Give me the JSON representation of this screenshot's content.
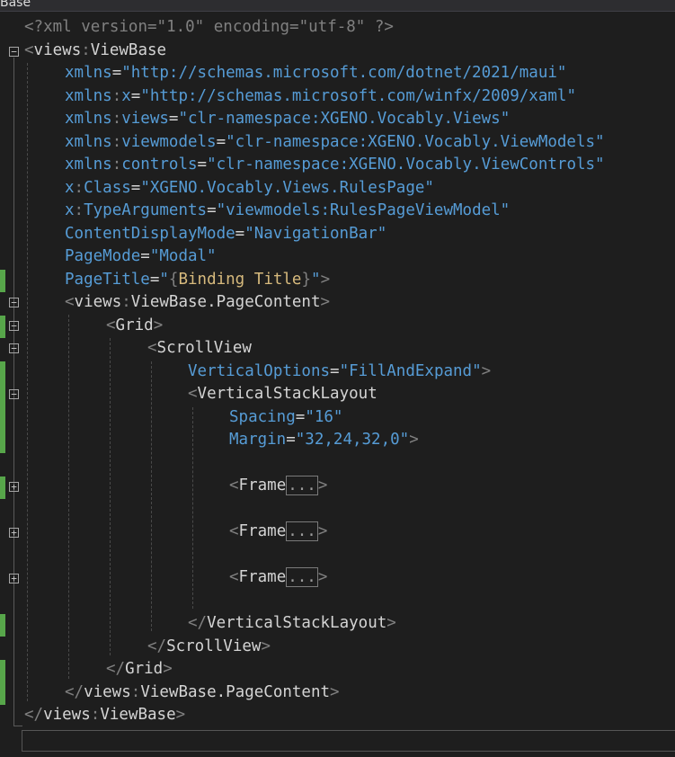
{
  "tab": {
    "title": "Base"
  },
  "lines": [
    "<?xml version=\"1.0\" encoding=\"utf-8\" ?>",
    "<views:ViewBase",
    "xmlns=\"http://schemas.microsoft.com/dotnet/2021/maui\"",
    "xmlns:x=\"http://schemas.microsoft.com/winfx/2009/xaml\"",
    "xmlns:views=\"clr-namespace:XGENO.Vocably.Views\"",
    "xmlns:viewmodels=\"clr-namespace:XGENO.Vocably.ViewModels\"",
    "xmlns:controls=\"clr-namespace:XGENO.Vocably.ViewControls\"",
    "x:Class=\"XGENO.Vocably.Views.RulesPage\"",
    "x:TypeArguments=\"viewmodels:RulesPageViewModel\"",
    "ContentDisplayMode=\"NavigationBar\"",
    "PageMode=\"Modal\"",
    "PageTitle=\"{Binding Title}\">",
    "<views:ViewBase.PageContent>",
    "<Grid>",
    "<ScrollView",
    "VerticalOptions=\"FillAndExpand\">",
    "<VerticalStackLayout",
    "Spacing=\"16\"",
    "Margin=\"32,24,32,0\">",
    "",
    "<Frame...>",
    "",
    "<Frame...>",
    "",
    "<Frame...>",
    "",
    "</VerticalStackLayout>",
    "</ScrollView>",
    "</Grid>",
    "</views:ViewBase.PageContent>",
    "</views:ViewBase>"
  ],
  "code": {
    "xml_decl": {
      "open": "<?xml",
      "version_attr": " version",
      "eq": "=",
      "version_val": "\"1.0\"",
      "enc_attr": " encoding",
      "enc_val": "\"utf-8\"",
      "close": " ?>"
    },
    "viewbase_open": {
      "lt": "<",
      "ns": "views",
      "colon": ":",
      "el": "ViewBase"
    },
    "xmlns": {
      "name": "xmlns",
      "val": "\"http://schemas.microsoft.com/dotnet/2021/maui\""
    },
    "xmlns_x": {
      "pre": "xmlns",
      "colon": ":",
      "name": "x",
      "val": "\"http://schemas.microsoft.com/winfx/2009/xaml\""
    },
    "xmlns_views": {
      "pre": "xmlns",
      "colon": ":",
      "name": "views",
      "val": "\"clr-namespace:XGENO.Vocably.Views\""
    },
    "xmlns_viewmodels": {
      "pre": "xmlns",
      "colon": ":",
      "name": "viewmodels",
      "val": "\"clr-namespace:XGENO.Vocably.ViewModels\""
    },
    "xmlns_controls": {
      "pre": "xmlns",
      "colon": ":",
      "name": "controls",
      "val": "\"clr-namespace:XGENO.Vocably.ViewControls\""
    },
    "x_class": {
      "pre": "x",
      "colon": ":",
      "name": "Class",
      "val": "\"XGENO.Vocably.Views.RulesPage\""
    },
    "x_typeargs": {
      "pre": "x",
      "colon": ":",
      "name": "TypeArguments",
      "val": "\"viewmodels:RulesPageViewModel\""
    },
    "content_display": {
      "name": "ContentDisplayMode",
      "val": "\"NavigationBar\""
    },
    "page_mode": {
      "name": "PageMode",
      "val": "\"Modal\""
    },
    "page_title": {
      "name": "PageTitle",
      "q1": "\"",
      "b1": "{",
      "binding": "Binding",
      "sp": " ",
      "title": "Title",
      "b2": "}",
      "q2": "\"",
      "close": ">"
    },
    "page_content_open": {
      "lt": "<",
      "ns": "views",
      "colon": ":",
      "el": "ViewBase.PageContent",
      "gt": ">"
    },
    "grid_open": {
      "lt": "<",
      "el": "Grid",
      "gt": ">"
    },
    "scroll_open": {
      "lt": "<",
      "el": "ScrollView"
    },
    "vertical_options": {
      "name": "VerticalOptions",
      "val": "\"FillAndExpand\"",
      "gt": ">"
    },
    "vsl_open": {
      "lt": "<",
      "el": "VerticalStackLayout"
    },
    "spacing": {
      "name": "Spacing",
      "val": "\"16\""
    },
    "margin": {
      "name": "Margin",
      "val": "\"32,24,32,0\"",
      "gt": ">"
    },
    "frame": {
      "lt": "<",
      "el": "Frame",
      "dots": "...",
      "gt": ">"
    },
    "vsl_close": {
      "lt": "</",
      "el": "VerticalStackLayout",
      "gt": ">"
    },
    "scroll_close": {
      "lt": "</",
      "el": "ScrollView",
      "gt": ">"
    },
    "grid_close": {
      "lt": "</",
      "el": "Grid",
      "gt": ">"
    },
    "page_content_close": {
      "lt": "</",
      "ns": "views",
      "colon": ":",
      "el": "ViewBase.PageContent",
      "gt": ">"
    },
    "viewbase_close": {
      "lt": "</",
      "ns": "views",
      "colon": ":",
      "el": "ViewBase",
      "gt": ">"
    }
  },
  "gutter": {
    "fold_open_glyph": "−",
    "fold_closed_glyph": "+"
  },
  "colors": {
    "background": "#1e1e1e",
    "change_marker": "#57a64a",
    "attribute": "#569cd6",
    "element": "#d4d4d4",
    "binding": "#d7ba7d"
  }
}
